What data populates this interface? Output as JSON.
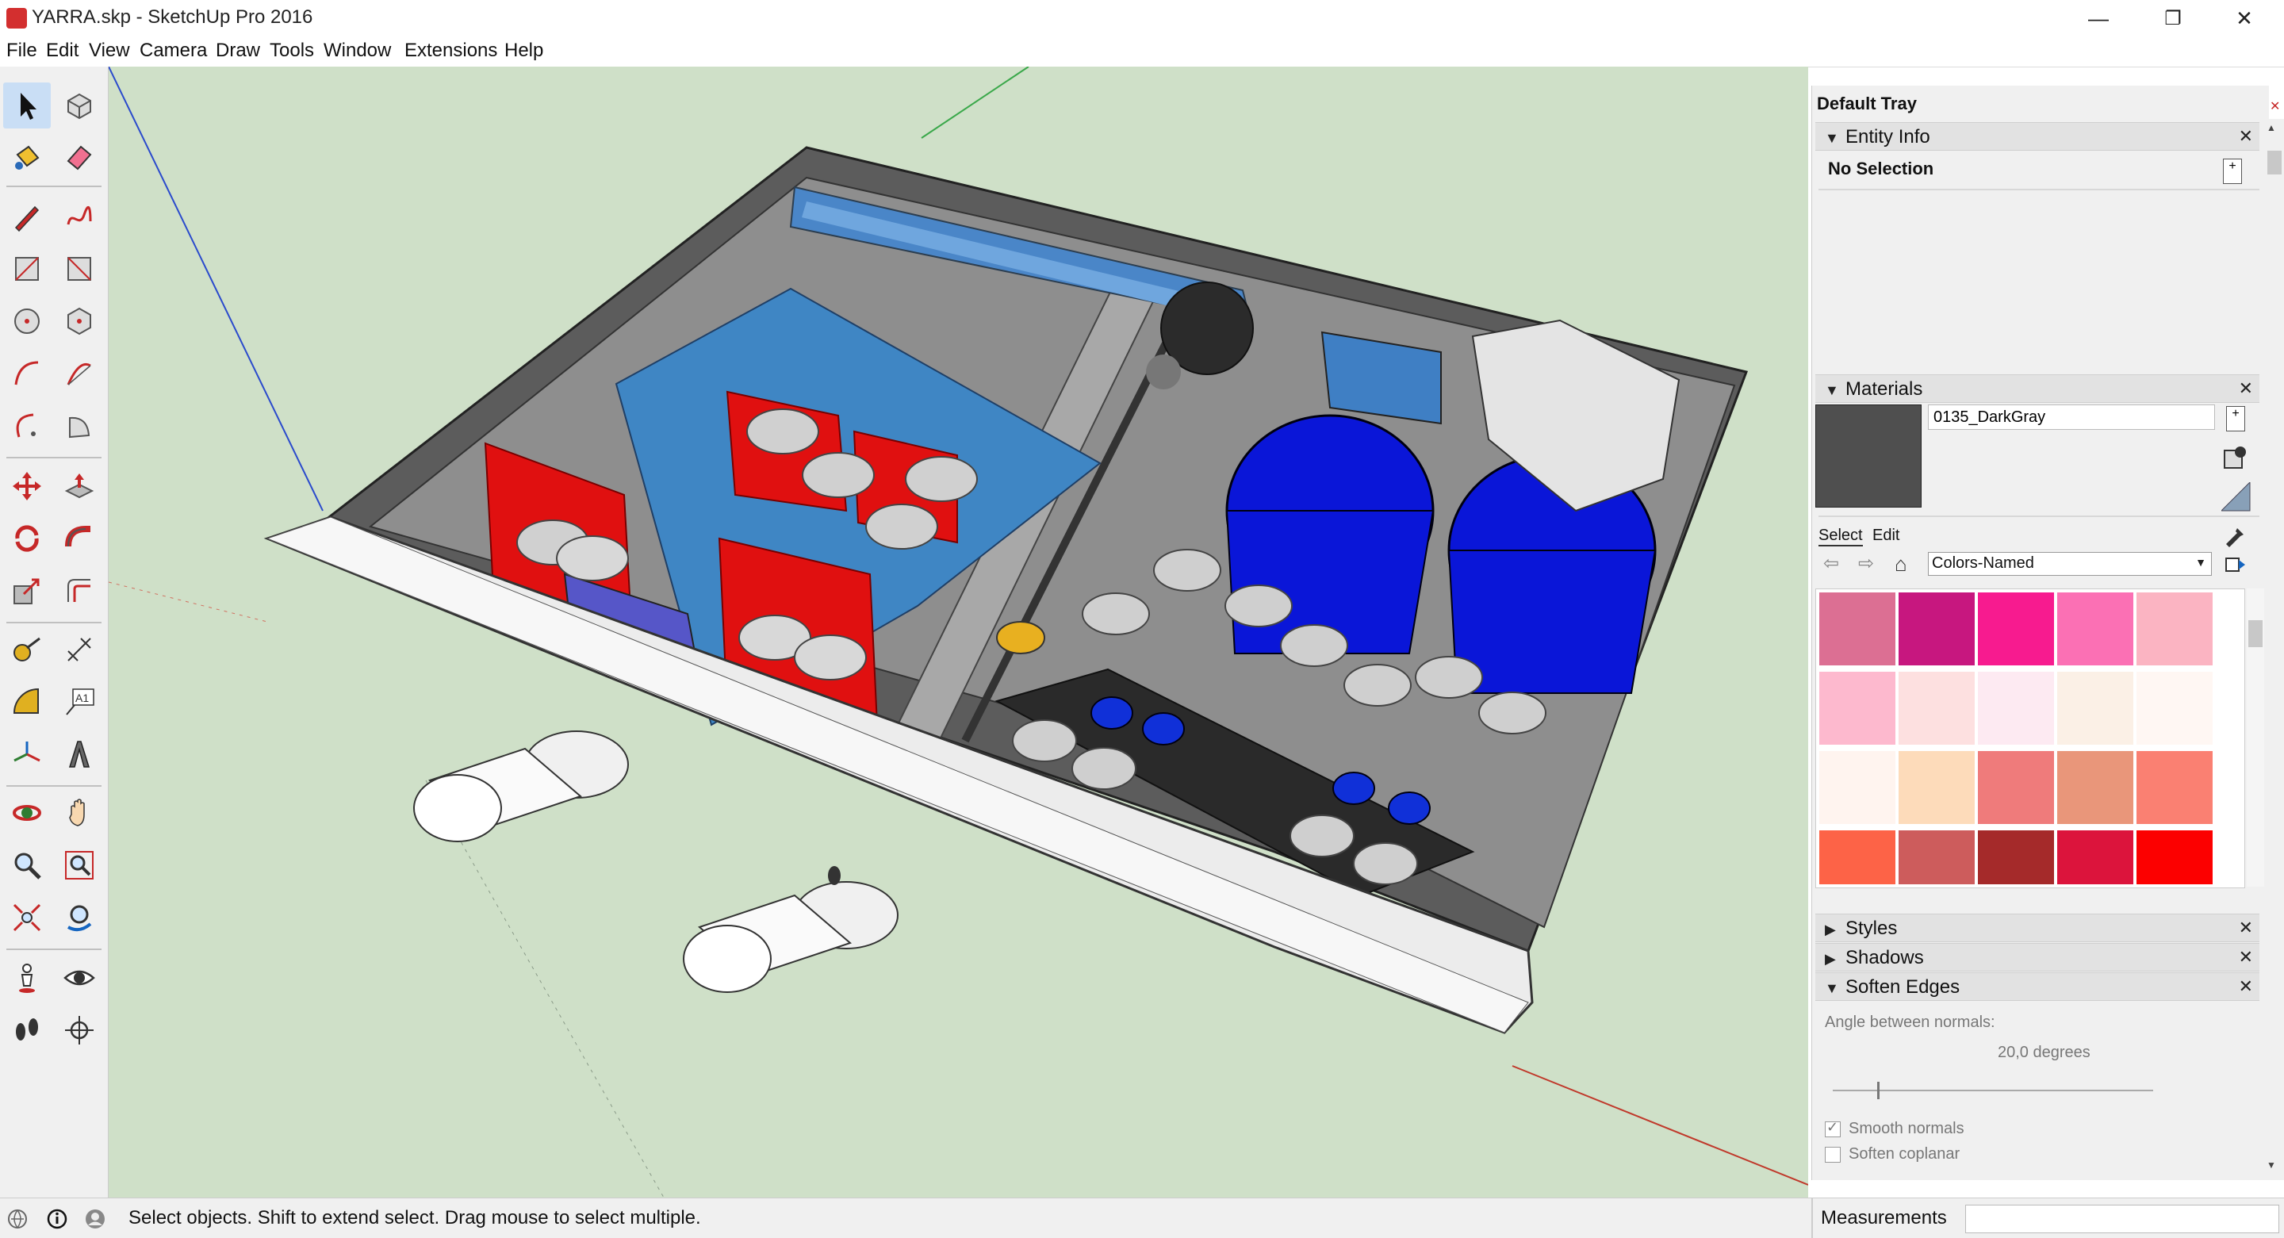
{
  "window": {
    "title": "YARRA.skp - SketchUp Pro 2016",
    "minimize": "—",
    "restore": "❐",
    "close": "✕"
  },
  "menu": [
    "File",
    "Edit",
    "View",
    "Camera",
    "Draw",
    "Tools",
    "Window",
    "Extensions",
    "Help"
  ],
  "tray": {
    "title": "Default Tray",
    "entity_info": {
      "label": "Entity Info",
      "selection": "No Selection"
    },
    "materials": {
      "label": "Materials",
      "current_material": "0135_DarkGray",
      "current_color": "#4f4f4f",
      "tab_select": "Select",
      "tab_edit": "Edit",
      "library": "Colors-Named",
      "swatches": [
        "#dc6f93",
        "#c7177f",
        "#f71b8f",
        "#fb70b4",
        "#fbb4c2",
        "#fdb9ce",
        "#fde0e0",
        "#fdeaf2",
        "#fbf0e6",
        "#fff7f3",
        "#fff4ef",
        "#fddbba",
        "#ef7b7b",
        "#e9967a",
        "#fa8072",
        "#fd6347",
        "#cd5c5c",
        "#a52a2a",
        "#dc143c",
        "#fc0000"
      ]
    },
    "styles": {
      "label": "Styles"
    },
    "shadows": {
      "label": "Shadows"
    },
    "soften_edges": {
      "label": "Soften Edges",
      "angle_label": "Angle between normals:",
      "angle_value": "20,0  degrees",
      "smooth_normals": "Smooth normals",
      "soften_coplanar": "Soften coplanar"
    }
  },
  "status": {
    "hint": "Select objects. Shift to extend select. Drag mouse to select multiple.",
    "measurements_label": "Measurements"
  },
  "tools": [
    "select-icon",
    "component-icon",
    "paint-bucket-icon",
    "eraser-icon",
    "pencil-icon",
    "freehand-icon",
    "rectangle-icon",
    "rotated-rectangle-icon",
    "circle-icon",
    "polygon-icon",
    "arc-icon",
    "two-point-arc-icon",
    "three-point-arc-icon",
    "pie-icon",
    "move-icon",
    "push-pull-icon",
    "rotate-icon",
    "follow-me-icon",
    "scale-icon",
    "offset-icon",
    "tape-measure-icon",
    "dimension-icon",
    "protractor-icon",
    "text-icon",
    "axes-icon",
    "3d-text-icon",
    "orbit-icon",
    "pan-icon",
    "zoom-icon",
    "zoom-window-icon",
    "zoom-extents-icon",
    "previous-view-icon",
    "position-camera-icon",
    "look-around-icon",
    "walk-icon",
    "section-plane-icon"
  ]
}
